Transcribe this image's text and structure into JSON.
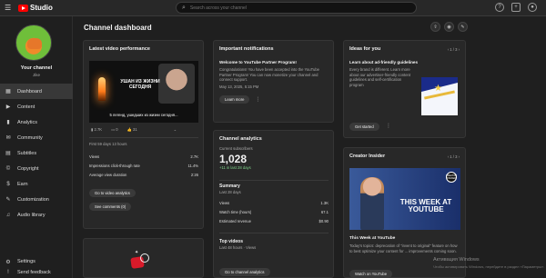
{
  "app": {
    "logo_text": "Studio"
  },
  "search": {
    "placeholder": "Search across your channel"
  },
  "sidebar": {
    "channel_name": "Your channel",
    "channel_sub": "Jike",
    "items": [
      {
        "label": "Dashboard",
        "icon": "dashboard-icon",
        "glyph": "▦"
      },
      {
        "label": "Content",
        "icon": "content-icon",
        "glyph": "▶"
      },
      {
        "label": "Analytics",
        "icon": "analytics-icon",
        "glyph": "▮"
      },
      {
        "label": "Community",
        "icon": "community-icon",
        "glyph": "✉"
      },
      {
        "label": "Subtitles",
        "icon": "subtitles-icon",
        "glyph": "▤"
      },
      {
        "label": "Copyright",
        "icon": "copyright-icon",
        "glyph": "©"
      },
      {
        "label": "Earn",
        "icon": "earn-icon",
        "glyph": "$"
      },
      {
        "label": "Customization",
        "icon": "customization-icon",
        "glyph": "✎"
      },
      {
        "label": "Audio library",
        "icon": "audio-library-icon",
        "glyph": "♫"
      }
    ],
    "bottom": [
      {
        "label": "Settings",
        "glyph": "⚙"
      },
      {
        "label": "Send feedback",
        "glyph": "!"
      }
    ]
  },
  "main": {
    "title": "Channel dashboard"
  },
  "latest_video": {
    "title": "Latest video performance",
    "thumb_caption": "УШАН ИЗ ЖИЗНИ СЕГОДНЯ",
    "thumb_under": "5 легенд, ушедших из жизни сегодня...",
    "stats": {
      "views": "2.7K",
      "comments": "0",
      "likes": "31"
    },
    "period": "First 59 days 13 hours",
    "metrics": [
      {
        "label": "Views",
        "value": "2.7K"
      },
      {
        "label": "Impressions click-through rate",
        "value": "11.4%"
      },
      {
        "label": "Average view duration",
        "value": "2:26"
      }
    ],
    "btn_analytics": "Go to video analytics",
    "btn_comments": "See comments (0)"
  },
  "notifications": {
    "title": "Important notifications",
    "heading": "Welcome to YouTube Partner Program!",
    "body": "Congratulations! You have been accepted into the YouTube Partner Program! You can now monetize your channel and connect support.",
    "date": "May 13, 2025, 5:15 PM",
    "btn": "Learn more"
  },
  "analytics": {
    "title": "Channel analytics",
    "subs_label": "Current subscribers",
    "subs_value": "1,028",
    "subs_change": "+11 in last 28 days",
    "summary_title": "Summary",
    "summary_period": "Last 28 days",
    "rows": [
      {
        "label": "Views",
        "value": "1.3K"
      },
      {
        "label": "Watch time (hours)",
        "value": "67.1"
      },
      {
        "label": "Estimated revenue",
        "value": "$0.90"
      }
    ],
    "top_title": "Top videos",
    "top_period": "Last 48 hours · Views",
    "btn": "Go to channel analytics"
  },
  "ideas": {
    "title": "Ideas for you",
    "pager": "1 / 3",
    "heading": "Learn about ad-friendly guidelines",
    "body": "Every brand is different. Learn more about our advertiser-friendly content guidelines and self-certification program",
    "btn": "Get started"
  },
  "creator": {
    "title": "Creator Insider",
    "pager": "1 / 3",
    "thumb_text": "THIS WEEK AT YOUTUBE",
    "badge": "CREATOR INSIDER",
    "heading": "This Week at YouTube",
    "body": "Today's topics: deprecation of \"invent to original\" feature on how to best optimize your content for ... improvements coming soon.",
    "btn": "Watch on YouTube"
  },
  "watermark": {
    "line1": "Активация Windows",
    "line2": "Чтобы активировать Windows, перейдите в раздел «Параметры»."
  }
}
